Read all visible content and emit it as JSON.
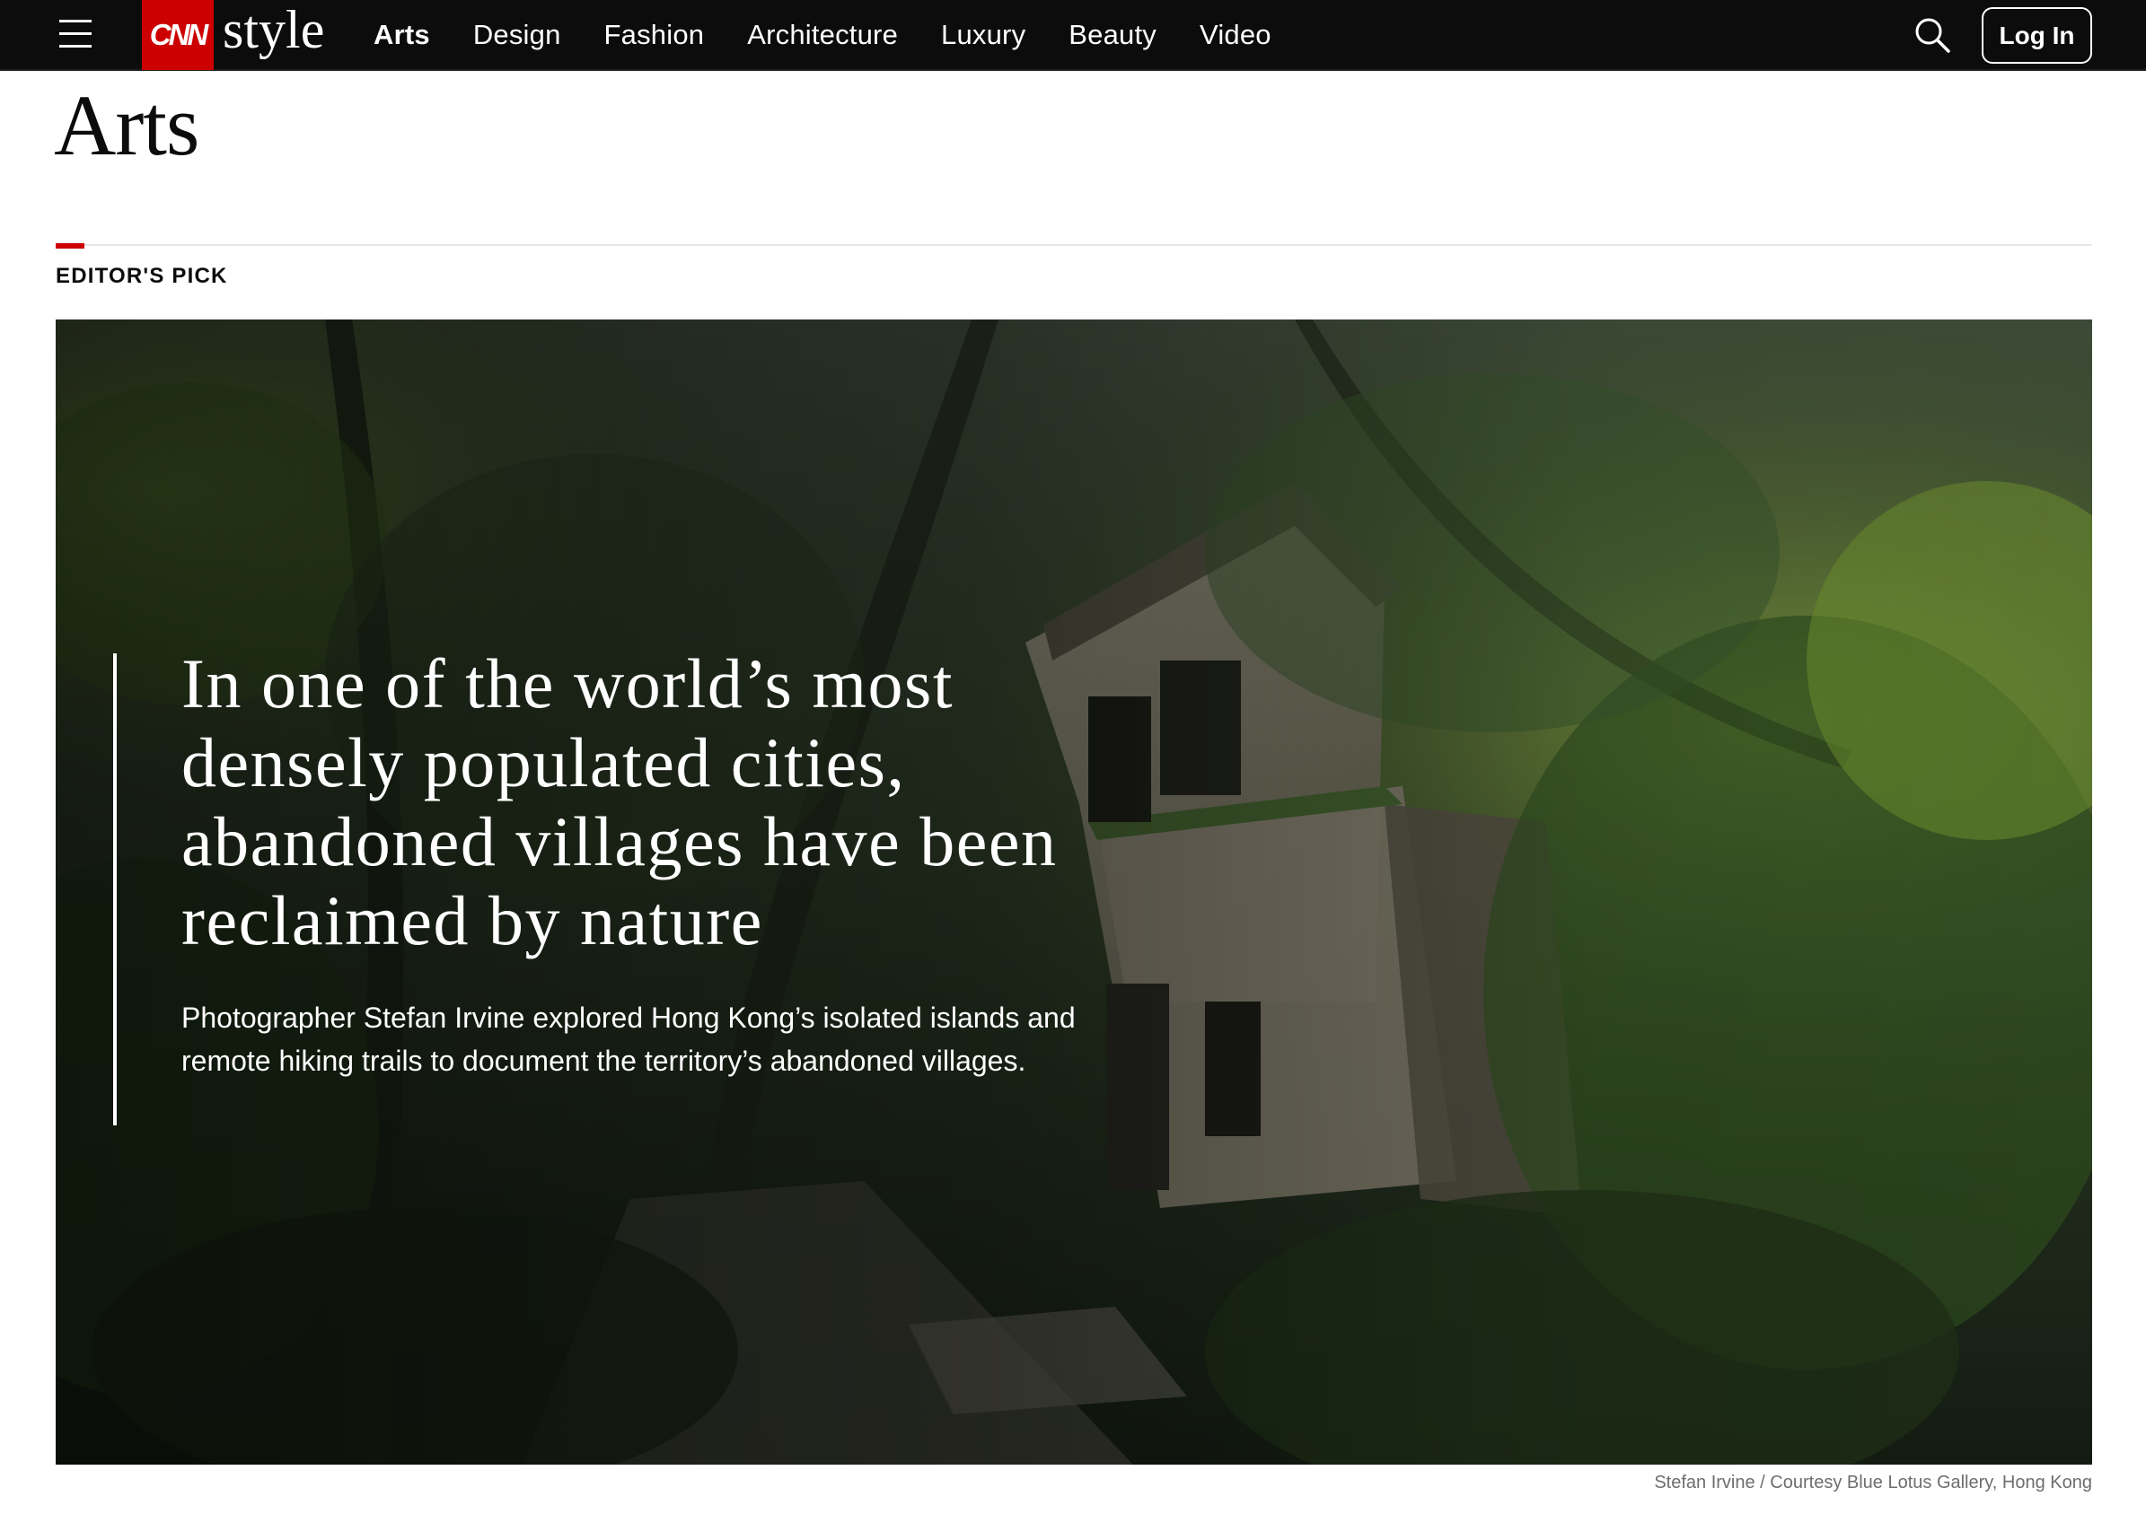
{
  "nav": {
    "brand_cnn": "CNN",
    "brand_style": "style",
    "links": [
      {
        "label": "Arts",
        "active": true
      },
      {
        "label": "Design"
      },
      {
        "label": "Fashion"
      },
      {
        "label": "Architecture"
      },
      {
        "label": "Luxury"
      },
      {
        "label": "Beauty"
      },
      {
        "label": "Video"
      }
    ],
    "login_label": "Log In",
    "icons": {
      "menu": "hamburger-icon",
      "search": "search-icon"
    }
  },
  "page": {
    "title": "Arts",
    "section_label": "EDITOR'S PICK"
  },
  "hero": {
    "headline": "In one of the world’s most densely populated cities, abandoned villages have been reclaimed by nature",
    "dek": "Photographer Stefan Irvine explored Hong Kong’s isolated islands and remote hiking trails to document the territory’s abandoned villages.",
    "credit": "Stefan Irvine / Courtesy Blue Lotus Gallery, Hong Kong"
  },
  "colors": {
    "nav_bg": "#0c0c0c",
    "brand_red": "#cc0000",
    "accent_red": "#cc0000",
    "text": "#0c0c0c",
    "credit_text": "#6e6e6e"
  }
}
